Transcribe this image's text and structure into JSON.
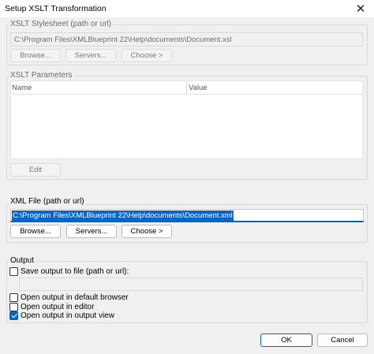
{
  "window": {
    "title": "Setup XSLT Transformation",
    "close_icon": "close-icon"
  },
  "stylesheet": {
    "legend": "XSLT Stylesheet (path or url)",
    "value": "C:\\Program Files\\XMLBlueprint 22\\Help\\documents\\Document.xsl",
    "browse": "Browse...",
    "servers": "Servers...",
    "choose": "Choose >"
  },
  "parameters": {
    "legend": "XSLT Parameters",
    "columns": [
      "Name",
      "Value"
    ],
    "rows": [],
    "edit": "Edit"
  },
  "xml_file": {
    "legend": "XML File (path or url)",
    "value": "C:\\Program Files\\XMLBlueprint 22\\Help\\documents\\Document.xml",
    "browse": "Browse...",
    "servers": "Servers...",
    "choose": "Choose >"
  },
  "output": {
    "legend": "Output",
    "save_label": "Save output to file (path or url):",
    "save_checked": false,
    "save_path": "",
    "options": [
      {
        "label": "Open output in default browser",
        "checked": false
      },
      {
        "label": "Open output in editor",
        "checked": false
      },
      {
        "label": "Open output in output view",
        "checked": true
      }
    ]
  },
  "footer": {
    "ok": "OK",
    "cancel": "Cancel"
  },
  "colors": {
    "accent": "#0067c0",
    "selection": "#0a64c8",
    "dialog_bg": "#f0f0f0"
  }
}
